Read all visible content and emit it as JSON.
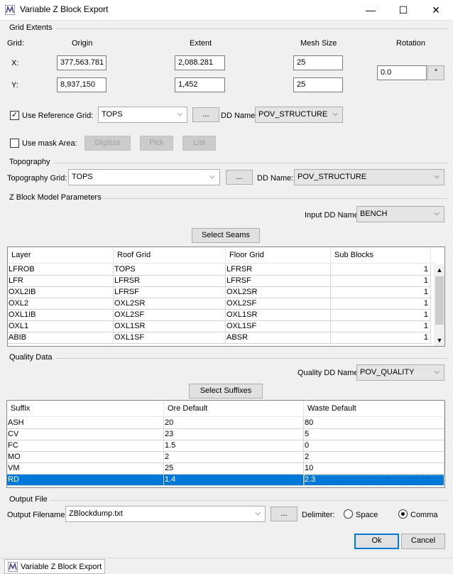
{
  "window": {
    "title": "Variable Z Block Export",
    "minimize_icon": "—",
    "maximize_icon": "☐",
    "close_icon": "✕"
  },
  "grid_extents": {
    "group": "Grid Extents",
    "grid_label": "Grid:",
    "origin_label": "Origin",
    "extent_label": "Extent",
    "mesh_label": "Mesh Size",
    "rotation_label": "Rotation",
    "x_label": "X:",
    "y_label": "Y:",
    "x_origin": "377,563.781",
    "x_extent": "2,088.281",
    "x_mesh": "25",
    "y_origin": "8,937,150",
    "y_extent": "1,452",
    "y_mesh": "25",
    "rotation": "0.0",
    "degree_button": "°",
    "use_ref_grid_label": "Use Reference Grid:",
    "use_ref_grid_checked": true,
    "ref_grid": "TOPS",
    "browse": "...",
    "dd_name_label": "DD Name:",
    "dd_name": "POV_STRUCTURE",
    "use_mask_label": "Use mask Area:",
    "use_mask_checked": false,
    "digitize": "Digitize",
    "pick": "Pick",
    "list": "List"
  },
  "topography": {
    "group": "Topography",
    "grid_label": "Topography Grid:",
    "grid": "TOPS",
    "browse": "...",
    "dd_name_label": "DD Name:",
    "dd_name": "POV_STRUCTURE"
  },
  "zblock": {
    "group": "Z Block Model Parameters",
    "input_dd_label": "Input DD Name:",
    "input_dd": "BENCH",
    "select_seams": "Select Seams",
    "columns": [
      "Layer",
      "Roof Grid",
      "Floor Grid",
      "Sub Blocks"
    ],
    "rows": [
      [
        "LFROB",
        "TOPS",
        "LFRSR",
        "1"
      ],
      [
        "LFR",
        "LFRSR",
        "LFRSF",
        "1"
      ],
      [
        "OXL2IB",
        "LFRSF",
        "OXL2SR",
        "1"
      ],
      [
        "OXL2",
        "OXL2SR",
        "OXL2SF",
        "1"
      ],
      [
        "OXL1IB",
        "OXL2SF",
        "OXL1SR",
        "1"
      ],
      [
        "OXL1",
        "OXL1SR",
        "OXL1SF",
        "1"
      ],
      [
        "ABIB",
        "OXL1SF",
        "ABSR",
        "1"
      ]
    ]
  },
  "quality": {
    "group": "Quality Data",
    "dd_label": "Quality DD Name:",
    "dd_name": "POV_QUALITY",
    "select_suffixes": "Select Suffixes",
    "columns": [
      "Suffix",
      "Ore Default",
      "Waste Default"
    ],
    "rows": [
      [
        "ASH",
        "20",
        "80"
      ],
      [
        "CV",
        "23",
        "5"
      ],
      [
        "FC",
        "1.5",
        "0"
      ],
      [
        "MO",
        "2",
        "2"
      ],
      [
        "VM",
        "25",
        "10"
      ],
      [
        "RD",
        "1.4",
        "2.3"
      ]
    ]
  },
  "output": {
    "group": "Output File",
    "filename_label": "Output Filename:",
    "filename": "ZBlockdump.txt",
    "browse": "...",
    "delimiter_label": "Delimiter:",
    "space": "Space",
    "comma": "Comma",
    "selected_delimiter": "Comma"
  },
  "footer": {
    "ok": "Ok",
    "cancel": "Cancel"
  },
  "taskbar": {
    "item": "Variable Z Block Export"
  },
  "colors": {
    "selection": "#0078d7",
    "window_bg": "#f0f0f0"
  }
}
